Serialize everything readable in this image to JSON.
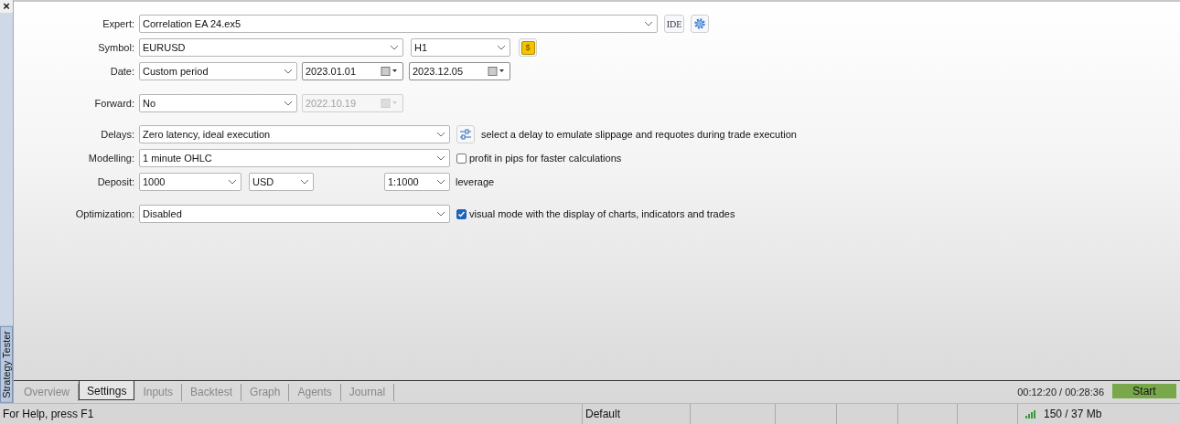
{
  "side_panel": {
    "close": "×",
    "title": "Strategy Tester"
  },
  "form": [
    {
      "label": "Expert:",
      "controls": [
        {
          "kind": "select",
          "value": "Correlation EA 24.ex5",
          "disabled": false
        },
        {
          "kind": "ide",
          "text": "IDE"
        },
        {
          "kind": "gear"
        }
      ]
    },
    {
      "label": "Symbol:",
      "controls": [
        {
          "kind": "select",
          "value": "EURUSD",
          "disabled": false
        },
        {
          "kind": "select",
          "value": "H1",
          "disabled": false
        },
        {
          "kind": "coin",
          "text": "$"
        }
      ]
    },
    {
      "label": "Date:",
      "controls": [
        {
          "kind": "select",
          "value": "Custom period",
          "disabled": false
        },
        {
          "kind": "date",
          "value": "2023.01.01",
          "disabled": false
        },
        {
          "kind": "date",
          "value": "2023.12.05",
          "disabled": false
        }
      ]
    },
    {
      "label": "Forward:",
      "controls": [
        {
          "kind": "select",
          "value": "No",
          "disabled": false
        },
        {
          "kind": "date",
          "value": "2022.10.19",
          "disabled": true
        }
      ]
    },
    {
      "label": "Delays:",
      "controls": [
        {
          "kind": "select",
          "value": "Zero latency, ideal execution",
          "disabled": false
        },
        {
          "kind": "sliders"
        },
        {
          "kind": "note",
          "text": "select a delay to emulate slippage and requotes during trade execution"
        }
      ]
    },
    {
      "label": "Modelling:",
      "controls": [
        {
          "kind": "select",
          "value": "1 minute OHLC",
          "disabled": false
        },
        {
          "kind": "checkbox",
          "checked": false,
          "text": "profit in pips for faster calculations"
        }
      ]
    },
    {
      "label": "Deposit:",
      "controls": [
        {
          "kind": "select",
          "value": "1000",
          "disabled": false
        },
        {
          "kind": "select",
          "value": "USD",
          "disabled": false
        },
        {
          "kind": "select",
          "value": "1:1000",
          "disabled": false
        },
        {
          "kind": "note",
          "text": "leverage"
        }
      ]
    },
    {
      "label": "Optimization:",
      "controls": [
        {
          "kind": "select",
          "value": "Disabled",
          "disabled": false
        },
        {
          "kind": "checkbox",
          "checked": true,
          "text": "visual mode with the display of charts, indicators and trades"
        }
      ]
    }
  ],
  "tabs": [
    {
      "label": "Overview",
      "selected": false
    },
    {
      "label": "Settings",
      "selected": true
    },
    {
      "label": "Inputs",
      "selected": false
    },
    {
      "label": "Backtest",
      "selected": false
    },
    {
      "label": "Graph",
      "selected": false
    },
    {
      "label": "Agents",
      "selected": false
    },
    {
      "label": "Journal",
      "selected": false
    }
  ],
  "progress_time": "00:12:20 / 00:28:36",
  "start_button": "Start",
  "status_bar": {
    "help": "For Help, press F1",
    "profile": "Default",
    "memory": "150 / 37 Mb"
  }
}
